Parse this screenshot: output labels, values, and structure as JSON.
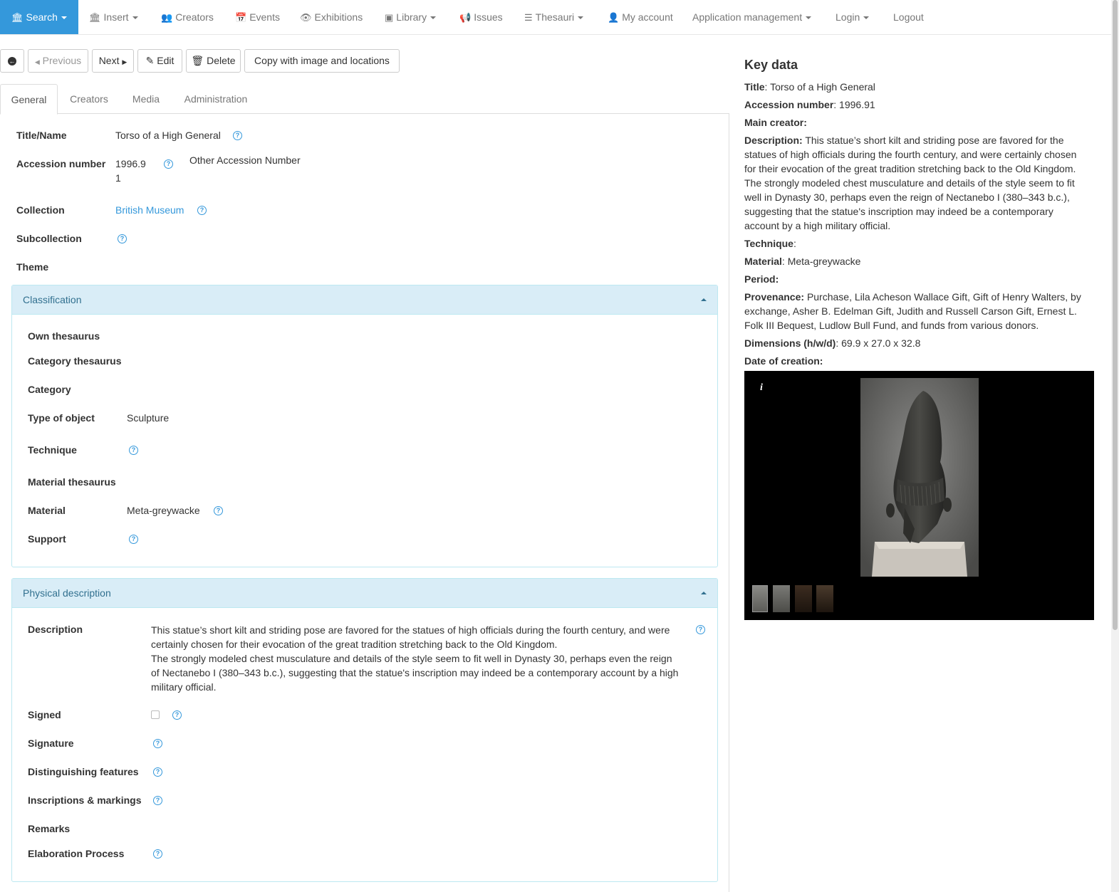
{
  "nav": {
    "search": "Search",
    "insert": "Insert",
    "creators": "Creators",
    "events": "Events",
    "exhibitions": "Exhibitions",
    "library": "Library",
    "issues": "Issues",
    "thesauri": "Thesauri",
    "my_account": "My account",
    "app_management": "Application management",
    "login": "Login",
    "logout": "Logout"
  },
  "toolbar": {
    "previous": "Previous",
    "next": "Next",
    "edit": "Edit",
    "delete": "Delete",
    "copy": "Copy with image and locations"
  },
  "tabs": [
    "General",
    "Creators",
    "Media",
    "Administration"
  ],
  "general": {
    "title_label": "Title/Name",
    "title_value": "Torso of a High General",
    "accession_label": "Accession number",
    "accession_value_line1": "1996.9",
    "accession_value_line2": "1",
    "other_accession_label": "Other Accession Number",
    "collection_label": "Collection",
    "collection_value": "British Museum",
    "subcollection_label": "Subcollection",
    "theme_label": "Theme"
  },
  "classification": {
    "header": "Classification",
    "own_thesaurus": "Own thesaurus",
    "category_thesaurus": "Category thesaurus",
    "category": "Category",
    "type_label": "Type of object",
    "type_value": "Sculpture",
    "technique": "Technique",
    "material_thesaurus": "Material thesaurus",
    "material_label": "Material",
    "material_value": "Meta-greywacke",
    "support": "Support"
  },
  "physical": {
    "header": "Physical description",
    "description_label": "Description",
    "description_p1": "This statue’s short kilt and striding pose are favored for the statues of high officials during the fourth century, and were certainly chosen for their evocation of the great tradition stretching back to the Old Kingdom.",
    "description_p2": "The strongly modeled chest musculature and details of the style seem to fit well in Dynasty 30, perhaps even the reign of Nectanebo I (380–343 b.c.), suggesting that the statue's inscription may indeed be a contemporary account by a high military official.",
    "signed": "Signed",
    "signature": "Signature",
    "distinguishing": "Distinguishing features",
    "inscriptions": "Inscriptions & markings",
    "remarks": "Remarks",
    "elaboration": "Elaboration Process"
  },
  "key_data": {
    "heading": "Key data",
    "title_label": "Title",
    "title_value": "Torso of a High General",
    "accession_label": "Accession number",
    "accession_value": "1996.91",
    "main_creator_label": "Main creator:",
    "description_label": "Description:",
    "description_value": "This statue’s short kilt and striding pose are favored for the statues of high officials during the fourth century, and were certainly chosen for their evocation of the great tradition stretching back to the Old Kingdom. The strongly modeled chest musculature and details of the style seem to fit well in Dynasty 30, perhaps even the reign of Nectanebo I (380–343 b.c.), suggesting that the statue's inscription may indeed be a contemporary account by a high military official.",
    "technique_label": "Technique",
    "material_label": "Material",
    "material_value": "Meta-greywacke",
    "period_label": "Period:",
    "provenance_label": "Provenance:",
    "provenance_value": "Purchase, Lila Acheson Wallace Gift, Gift of Henry Walters, by exchange, Asher B. Edelman Gift, Judith and Russell Carson Gift, Ernest L. Folk III Bequest, Ludlow Bull Fund, and funds from various donors.",
    "dimensions_label": "Dimensions (h/w/d)",
    "dimensions_value": "69.9 x 27.0 x 32.8",
    "date_label": "Date of creation:",
    "info_icon": "i"
  },
  "colors": {
    "accent": "#3498db",
    "panel_head_bg": "#d9edf7",
    "panel_head_text": "#31708f"
  }
}
